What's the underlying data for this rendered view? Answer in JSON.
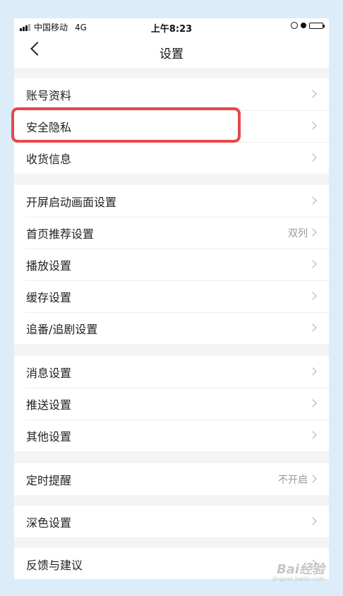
{
  "status_bar": {
    "carrier": "中国移动",
    "network": "4G",
    "time": "上午8:23"
  },
  "nav": {
    "title": "设置"
  },
  "groups": [
    {
      "items": [
        {
          "label": "账号资料",
          "value": ""
        },
        {
          "label": "安全隐私",
          "value": ""
        },
        {
          "label": "收货信息",
          "value": ""
        }
      ]
    },
    {
      "items": [
        {
          "label": "开屏启动画面设置",
          "value": ""
        },
        {
          "label": "首页推荐设置",
          "value": "双列"
        },
        {
          "label": "播放设置",
          "value": ""
        },
        {
          "label": "缓存设置",
          "value": ""
        },
        {
          "label": "追番/追剧设置",
          "value": ""
        }
      ]
    },
    {
      "items": [
        {
          "label": "消息设置",
          "value": ""
        },
        {
          "label": "推送设置",
          "value": ""
        },
        {
          "label": "其他设置",
          "value": ""
        }
      ]
    },
    {
      "items": [
        {
          "label": "定时提醒",
          "value": "不开启"
        }
      ]
    },
    {
      "items": [
        {
          "label": "深色设置",
          "value": ""
        }
      ]
    },
    {
      "items": [
        {
          "label": "反馈与建议",
          "value": ""
        }
      ]
    }
  ],
  "watermark": {
    "text": "Bai经验",
    "url": "jingyan.baidu.com"
  }
}
